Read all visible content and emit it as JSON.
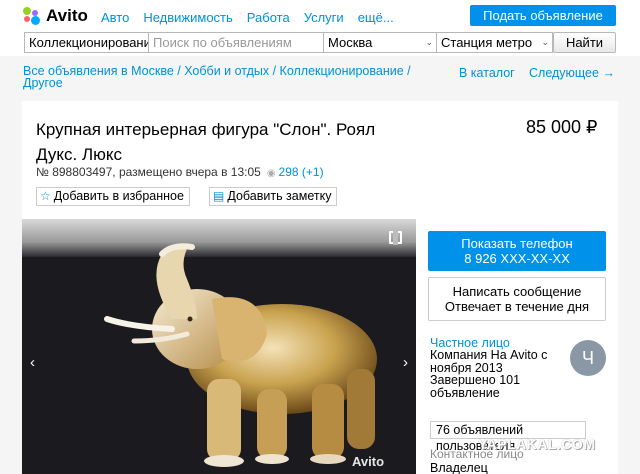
{
  "header": {
    "logo_text": "Avito",
    "nav": [
      "Авто",
      "Недвижимость",
      "Работа",
      "Услуги",
      "ещё..."
    ],
    "post_button": "Подать объявление"
  },
  "search": {
    "category": "Коллекционирование",
    "placeholder": "Поиск по объявлениям",
    "city": "Москва",
    "metro": "Станция метро",
    "submit": "Найти"
  },
  "breadcrumbs": {
    "text": "Все объявления в Москве / Хобби и отдых / Коллекционирование / Другое",
    "catalog": "В каталог",
    "next": "Следующее →"
  },
  "listing": {
    "title": "Крупная интерьерная фигура \"Слон\". Роял Дукс. Люкс",
    "price": "85 000 ₽",
    "meta": "№ 898803497, размещено вчера в 13:05",
    "views": "298 (+1)",
    "favorite": "Добавить в избранное",
    "note": "Добавить заметку",
    "photo_watermark": "Avito"
  },
  "sidebar": {
    "phone_line1": "Показать телефон",
    "phone_line2": "8 926 XXX-XX-XX",
    "msg_line1": "Написать сообщение",
    "msg_line2": "Отвечает в течение дня",
    "seller_type": "Частное лицо",
    "seller_info": "Компания На Avito с ноября 2013 Завершено 101 объявление",
    "avatar_letter": "Ч",
    "users_button": "76 объявлений пользователя",
    "contact_label": "Контактное лицо",
    "contact_name": "Владелец"
  },
  "watermark": "YAPLAKAL.COM",
  "colors": {
    "accent": "#0091ea",
    "link": "#0091d9"
  },
  "icons": [
    "avito-logo-icon",
    "star-icon",
    "note-icon",
    "eye-icon",
    "expand-icon",
    "arrow-left-icon",
    "arrow-right-icon"
  ]
}
